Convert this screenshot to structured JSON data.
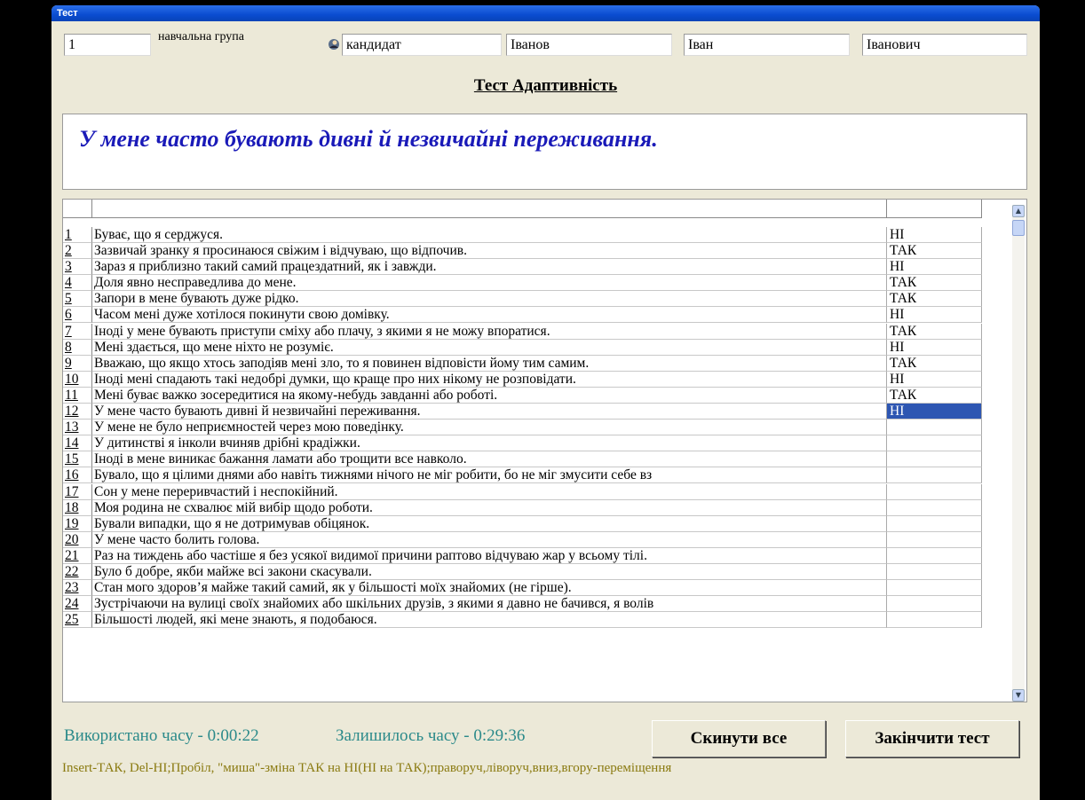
{
  "window": {
    "title": "Тест"
  },
  "header": {
    "group_number": "1",
    "group_label": "навчальна група",
    "role": "кандидат",
    "last_name": "Іванов",
    "first_name": "Іван",
    "patronymic": "Іванович",
    "icon": "user-icon"
  },
  "test_title": "Тест Адаптивність",
  "current_question": "У мене часто бувають дивні й незвичайні переживання.",
  "questions": [
    {
      "n": "1",
      "text": "Буває, що я серджуся.",
      "answer": "НІ"
    },
    {
      "n": "2",
      "text": "Зазвичай зранку я просинаюся свіжим і відчуваю, що відпочив.",
      "answer": "ТАК"
    },
    {
      "n": "3",
      "text": "Зараз я приблизно такий самий  працездатний, як і завжди.",
      "answer": "НІ"
    },
    {
      "n": "4",
      "text": "Доля явно несправедлива до мене.",
      "answer": "ТАК"
    },
    {
      "n": "5",
      "text": "Запори в мене бувають дуже рідко.",
      "answer": "ТАК"
    },
    {
      "n": "6",
      "text": "Часом мені дуже хотілося покинути свою домівку.",
      "answer": "НІ"
    },
    {
      "n": "7",
      "text": "Іноді у мене бувають приступи сміху або плачу, з якими я не можу впоратися.",
      "answer": "ТАК"
    },
    {
      "n": "8",
      "text": "Мені здається, що мене ніхто не розуміє.",
      "answer": "НІ"
    },
    {
      "n": "9",
      "text": "Вважаю, що якщо хтось заподіяв мені зло, то я повинен відповісти йому тим самим.",
      "answer": "ТАК"
    },
    {
      "n": "10",
      "text": "Іноді мені спадають такі недобрі думки, що краще про них нікому не розповідати.",
      "answer": "НІ"
    },
    {
      "n": "11",
      "text": "Мені буває важко зосередитися на якому-небудь завданні або роботі.",
      "answer": "ТАК"
    },
    {
      "n": "12",
      "text": "У мене часто бувають дивні й незвичайні переживання.",
      "answer": "НІ"
    },
    {
      "n": "13",
      "text": "У мене не було неприємностей через мою поведінку.",
      "answer": ""
    },
    {
      "n": "14",
      "text": "У дитинстві я інколи вчиняв дрібні крадіжки.",
      "answer": ""
    },
    {
      "n": "15",
      "text": "Іноді в мене виникає бажання ламати або трощити все навколо.",
      "answer": ""
    },
    {
      "n": "16",
      "text": "Бувало, що я цілими днями або навіть тижнями нічого не міг робити, бо не міг змусити себе вз",
      "answer": ""
    },
    {
      "n": "17",
      "text": "Сон у мене переривчастий і неспокійний.",
      "answer": ""
    },
    {
      "n": "18",
      "text": "Моя родина не схвалює мій вибір щодо роботи.",
      "answer": ""
    },
    {
      "n": "19",
      "text": "Бували випадки, що я не дотримував обіцянок.",
      "answer": ""
    },
    {
      "n": "20",
      "text": "У мене часто болить голова.",
      "answer": ""
    },
    {
      "n": "21",
      "text": "Раз на тиждень або частіше я без усякої видимої причини раптово відчуваю жар у всьому тілі.",
      "answer": ""
    },
    {
      "n": "22",
      "text": "Було б добре, якби майже всі закони скасували.",
      "answer": ""
    },
    {
      "n": "23",
      "text": "Стан мого здоров’я майже такий самий, як у більшості моїх знайомих (не гірше).",
      "answer": ""
    },
    {
      "n": "24",
      "text": "Зустрічаючи на вулиці своїх знайомих або шкільних друзів, з якими я давно не бачився, я волів",
      "answer": ""
    },
    {
      "n": "25",
      "text": "Більшості людей, які мене знають, я подобаюся.",
      "answer": ""
    }
  ],
  "selected_row": 12,
  "footer": {
    "time_used": "Використано часу - 0:00:22",
    "time_left": "Залишилось часу - 0:29:36",
    "reset_label": "Скинути все",
    "finish_label": "Закінчити тест",
    "hint": "Insert-ТАК, Del-НІ;Пробіл, \"миша\"-зміна ТАК на НІ(НІ на ТАК);праворуч,ліворуч,вниз,вгору-переміщення"
  },
  "colors": {
    "question": "#1a1ab8",
    "timer": "#2b8a8a",
    "hint": "#8a7a10",
    "selection": "#2d56b2"
  }
}
